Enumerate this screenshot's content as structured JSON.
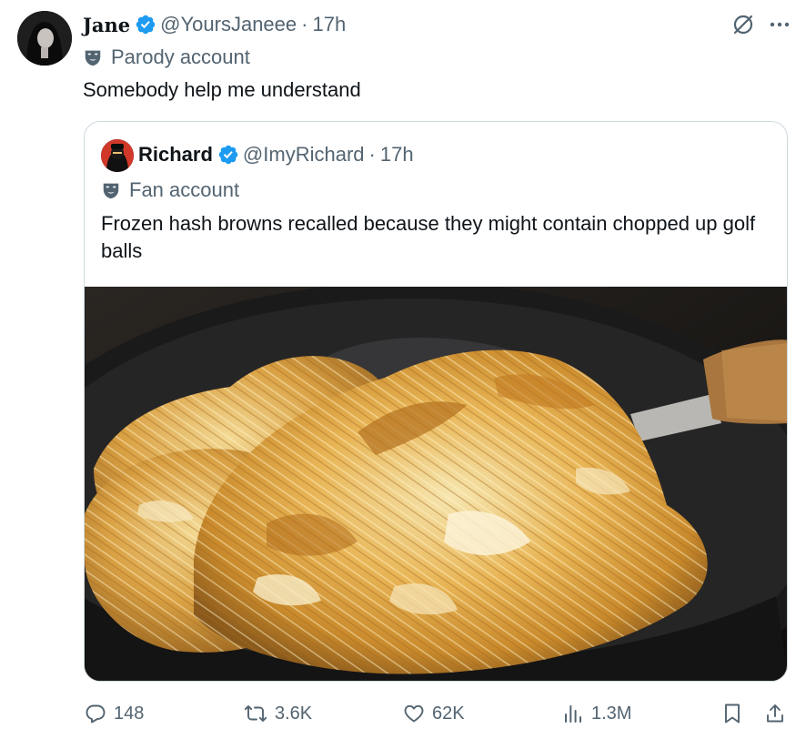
{
  "tweet": {
    "author_name": "Jane",
    "author_handle": "@YoursJaneee",
    "separator": "·",
    "time": "17h",
    "account_label": "Parody account",
    "text": "Somebody help me understand"
  },
  "quote": {
    "author_name": "Richard",
    "author_handle": "@ImyRichard",
    "separator": "·",
    "time": "17h",
    "account_label": "Fan account",
    "text": "Frozen hash browns recalled because they might contain chopped up golf balls"
  },
  "actions": {
    "replies": "148",
    "reposts": "3.6K",
    "likes": "62K",
    "views": "1.3M"
  },
  "colors": {
    "verified": "#1d9bf0",
    "secondary_text": "#536471",
    "border": "#cfd9de"
  },
  "icons": [
    "verified-badge-icon",
    "mask-icon",
    "grok-icon",
    "more-icon",
    "reply-icon",
    "repost-icon",
    "like-icon",
    "views-icon",
    "bookmark-icon",
    "share-icon"
  ]
}
